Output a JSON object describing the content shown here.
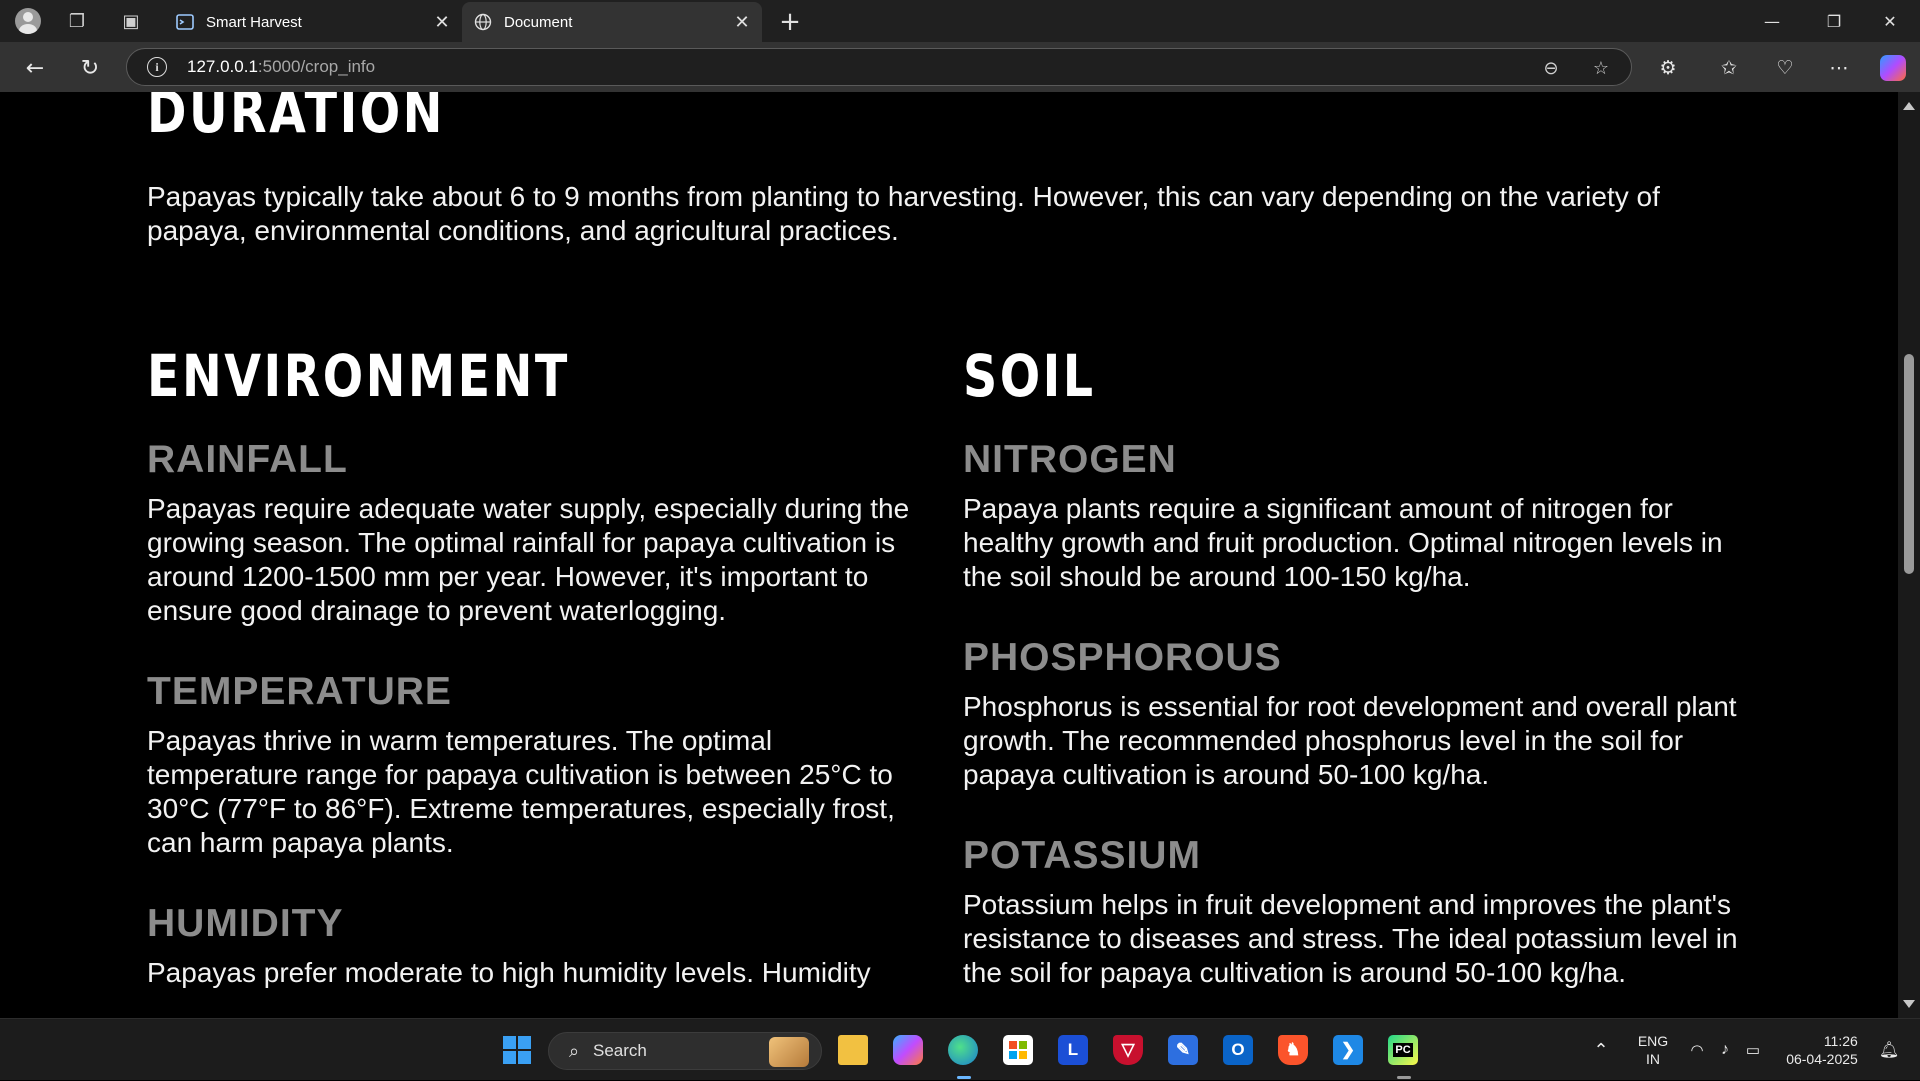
{
  "browser": {
    "tabs": [
      {
        "title": "Smart Harvest",
        "icon": "terminal-favicon-icon",
        "active": false
      },
      {
        "title": "Document",
        "icon": "globe-icon",
        "active": true
      }
    ],
    "new_tab_label": "+",
    "url": {
      "host": "127.0.0.1",
      "path": ":5000/crop_info"
    }
  },
  "page": {
    "duration_title": "DURATION",
    "duration_text": "Papayas typically take about 6 to 9 months from planting to harvesting. However, this can vary depending on the variety of papaya, environmental conditions, and agricultural practices.",
    "environment": {
      "title": "ENVIRONMENT",
      "sections": [
        {
          "title": "RAINFALL",
          "text": "Papayas require adequate water supply, especially during the growing season. The optimal rainfall for papaya cultivation is around 1200-1500 mm per year. However, it's important to ensure good drainage to prevent waterlogging."
        },
        {
          "title": "TEMPERATURE",
          "text": "Papayas thrive in warm temperatures. The optimal temperature range for papaya cultivation is between 25°C to 30°C (77°F to 86°F). Extreme temperatures, especially frost, can harm papaya plants."
        },
        {
          "title": "HUMIDITY",
          "text": "Papayas prefer moderate to high humidity levels. Humidity"
        }
      ]
    },
    "soil": {
      "title": "SOIL",
      "sections": [
        {
          "title": "NITROGEN",
          "text": "Papaya plants require a significant amount of nitrogen for healthy growth and fruit production. Optimal nitrogen levels in the soil should be around 100-150 kg/ha."
        },
        {
          "title": "PHOSPHOROUS",
          "text": "Phosphorus is essential for root development and overall plant growth. The recommended phosphorus level in the soil for papaya cultivation is around 50-100 kg/ha."
        },
        {
          "title": "POTASSIUM",
          "text": "Potassium helps in fruit development and improves the plant's resistance to diseases and stress. The ideal potassium level in the soil for papaya cultivation is around 50-100 kg/ha."
        }
      ]
    }
  },
  "taskbar": {
    "search_label": "Search",
    "lang_line1": "ENG",
    "lang_line2": "IN",
    "time": "11:26",
    "date": "06-04-2025"
  }
}
